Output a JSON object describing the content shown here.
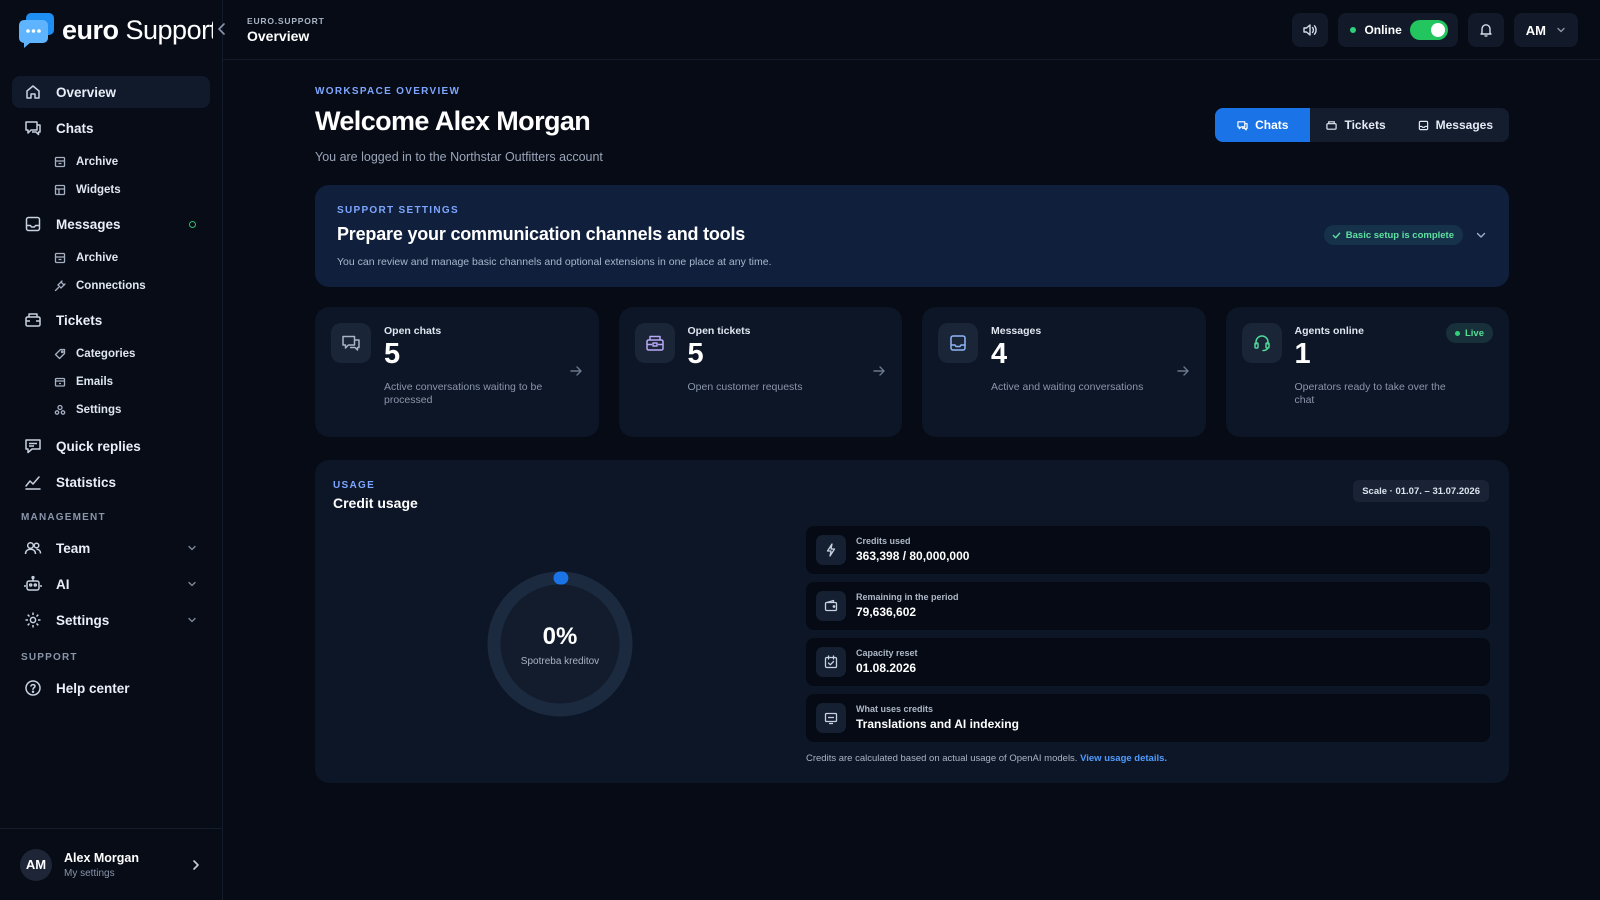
{
  "app": {
    "brand_bold": "euro",
    "brand_rest": " Support",
    "colors": {
      "accent": "#1a74e8",
      "online": "#22c55e",
      "eyebrow": "#7ea6ff",
      "link": "#4f9cff"
    }
  },
  "sidebar": {
    "items": [
      {
        "label": "Overview",
        "icon": "home-icon"
      },
      {
        "label": "Chats",
        "icon": "chat-icon"
      },
      {
        "label": "Archive",
        "icon": "archive-icon"
      },
      {
        "label": "Widgets",
        "icon": "widget-icon"
      },
      {
        "label": "Messages",
        "icon": "inbox-icon"
      },
      {
        "label": "Archive",
        "icon": "archive-icon"
      },
      {
        "label": "Connections",
        "icon": "plug-icon"
      },
      {
        "label": "Tickets",
        "icon": "ticket-icon"
      },
      {
        "label": "Categories",
        "icon": "tag-icon"
      },
      {
        "label": "Emails",
        "icon": "mail-icon"
      },
      {
        "label": "Settings",
        "icon": "users-cog-icon"
      },
      {
        "label": "Quick replies",
        "icon": "quick-reply-icon"
      },
      {
        "label": "Statistics",
        "icon": "stats-icon"
      }
    ],
    "management_title": "MANAGEMENT",
    "management": [
      {
        "label": "Team",
        "icon": "team-icon"
      },
      {
        "label": "AI",
        "icon": "robot-icon"
      },
      {
        "label": "Settings",
        "icon": "gear-icon"
      }
    ],
    "support_title": "SUPPORT",
    "support": [
      {
        "label": "Help center",
        "icon": "help-icon"
      }
    ],
    "user": {
      "initials": "AM",
      "name": "Alex Morgan",
      "sub": "My settings"
    }
  },
  "topbar": {
    "breadcrumb": "EURO.SUPPORT",
    "title": "Overview",
    "status": "Online",
    "avatar": "AM"
  },
  "main": {
    "eyebrow": "WORKSPACE OVERVIEW",
    "title": "Welcome Alex Morgan",
    "subtitle": "You are logged in to the Northstar Outfitters account",
    "tabs": [
      {
        "label": "Chats",
        "active": true
      },
      {
        "label": "Tickets",
        "active": false
      },
      {
        "label": "Messages",
        "active": false
      }
    ],
    "settings": {
      "eyebrow": "SUPPORT SETTINGS",
      "title": "Prepare your communication channels and tools",
      "desc": "You can review and manage basic channels and optional extensions in one place at any time.",
      "badge": "Basic setup is complete"
    },
    "stats": [
      {
        "label": "Open chats",
        "value": "5",
        "desc": "Active conversations waiting to be processed",
        "icon": "chat-icon"
      },
      {
        "label": "Open tickets",
        "value": "5",
        "desc": "Open customer requests",
        "icon": "ticket-icon"
      },
      {
        "label": "Messages",
        "value": "4",
        "desc": "Active and waiting conversations",
        "icon": "inbox-icon"
      },
      {
        "label": "Agents online",
        "value": "1",
        "desc": "Operators ready to take over the chat",
        "icon": "headset-icon",
        "badge": "Live"
      }
    ],
    "usage": {
      "eyebrow": "USAGE",
      "title": "Credit usage",
      "scale": "Scale · 01.07. – 31.07.2026",
      "gauge_value": "0%",
      "gauge_fraction": 0.0045,
      "gauge_label": "Spotreba kreditov",
      "rows": [
        {
          "label": "Credits used",
          "value": "363,398 / 80,000,000",
          "icon": "bolt-icon"
        },
        {
          "label": "Remaining in the period",
          "value": "79,636,602",
          "icon": "wallet-icon"
        },
        {
          "label": "Capacity reset",
          "value": "01.08.2026",
          "icon": "calendar-icon"
        },
        {
          "label": "What uses credits",
          "value": "Translations and AI indexing",
          "icon": "monitor-icon"
        }
      ],
      "note": "Credits are calculated based on actual usage of OpenAI models.",
      "note_link": "View usage details."
    }
  }
}
